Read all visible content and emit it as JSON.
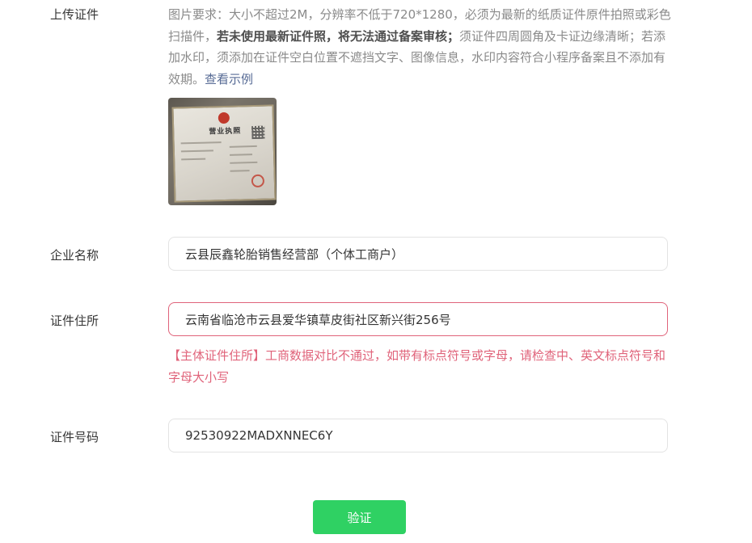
{
  "upload": {
    "label": "上传证件",
    "hint_plain_1": "图片要求：大小不超过2M，分辨率不低于720*1280，必须为最新的纸质证件原件拍照或彩色扫描件，",
    "hint_bold": "若未使用最新证件照，将无法通过备案审核；",
    "hint_plain_2": "须证件四周圆角及卡证边缘清晰；若添加水印，须添加在证件空白位置不遮挡文字、图像信息，水印内容符合小程序备案且不添加有效期。",
    "hint_link": "查看示例",
    "thumbnail_title": "营业执照"
  },
  "company_name": {
    "label": "企业名称",
    "value": "云县辰鑫轮胎销售经营部（个体工商户）"
  },
  "address": {
    "label": "证件住所",
    "value": "云南省临沧市云县爱华镇草皮街社区新兴街256号",
    "error": "【主体证件住所】工商数据对比不通过，如带有标点符号或字母，请检查中、英文标点符号和字母大小写"
  },
  "cert_number": {
    "label": "证件号码",
    "value": "92530922MADXNNEC6Y"
  },
  "verify_button": {
    "label": "验证"
  },
  "colors": {
    "primary_green": "#2fd163",
    "error_red": "#e0637a",
    "link_blue": "#576b95"
  }
}
